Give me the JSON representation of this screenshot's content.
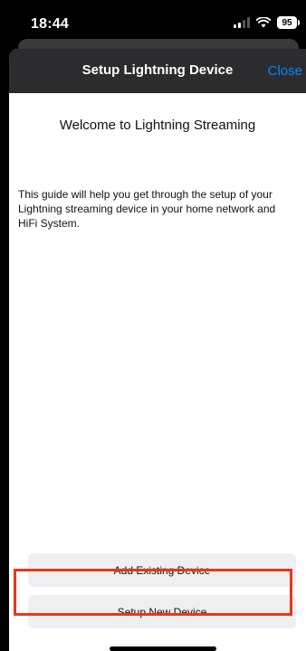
{
  "status_bar": {
    "time": "18:44",
    "battery": "95"
  },
  "nav": {
    "title": "Setup Lightning Device",
    "close_label": "Close"
  },
  "content": {
    "welcome": "Welcome to Lightning Streaming",
    "guide": "This guide will help you get through the setup of your Lightning streaming device in your home network and HiFi System."
  },
  "buttons": {
    "add_existing": "Add Existing Device",
    "setup_new": "Setup New Device"
  },
  "colors": {
    "accent": "#0a84ff",
    "highlight": "#e8361f",
    "nav_background": "#2c2c2e",
    "button_background": "#efefef"
  }
}
